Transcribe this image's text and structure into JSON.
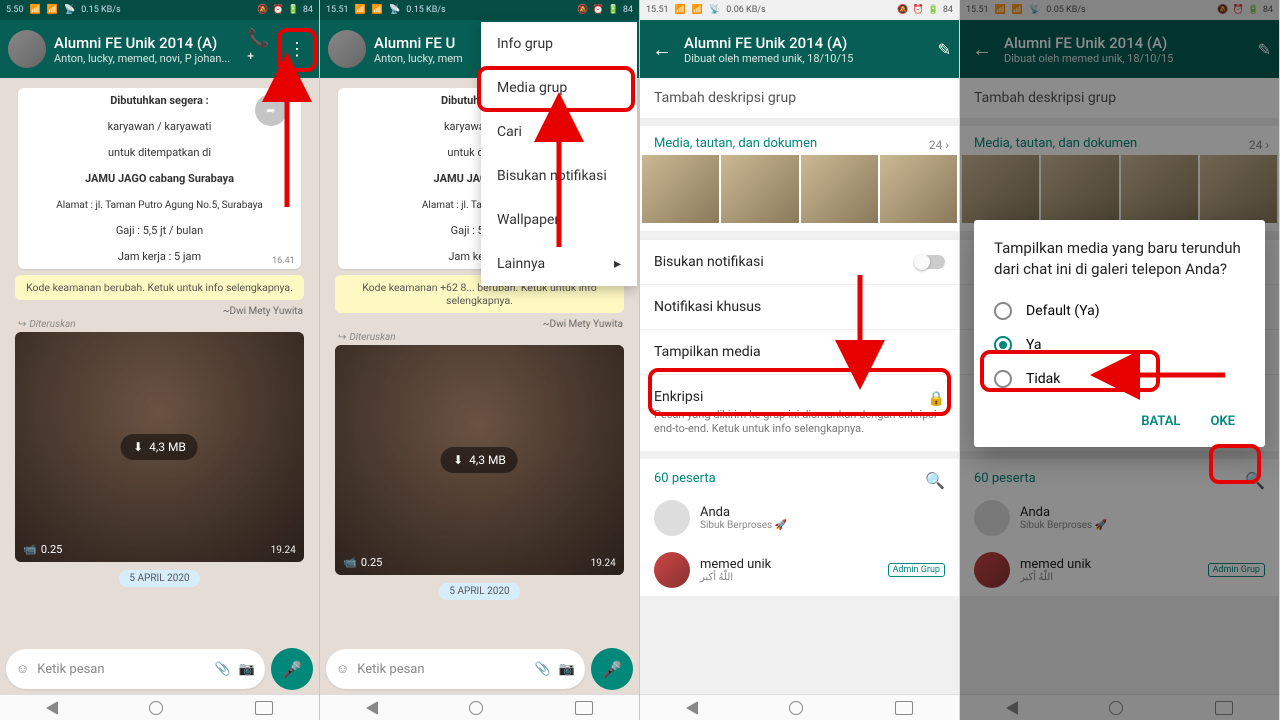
{
  "status1": {
    "time": "5.50",
    "net": "0.15 KB/s",
    "battery": "84"
  },
  "status2": {
    "time": "15.51",
    "net": "0.15 KB/s",
    "battery": "84"
  },
  "status3": {
    "time": "15.51",
    "net": "0.06 KB/s",
    "battery": "84"
  },
  "status4": {
    "time": "15.51",
    "net": "0.05 KB/s",
    "battery": "84"
  },
  "chat": {
    "title": "Alumni FE Unik 2014 (A)",
    "members": "Anton, lucky, memed, novi, P johan...",
    "created": "Dibuat oleh memed unik, 18/10/15",
    "msg_lines": [
      "Dibutuhkan segera :",
      "karyawan / karyawati",
      "untuk ditempatkan di",
      "JAMU JAGO cabang Surabaya",
      "Alamat : jl. Taman Putro Agung No.5, Surabaya",
      "Gaji : 5,5 jt / bulan",
      "Jam kerja : 5 jam"
    ],
    "msg_time": "16.41",
    "sec_notice": "Kode keamanan                        berubah. Ketuk untuk info selengkapnya.",
    "sec_notice2": "Kode keamanan +62 8... berubah. Ketuk untuk info selengkapnya.",
    "sender": "~Dwi Mety Yuwita",
    "forward": "Diteruskan",
    "dl_size": "4,3 MB",
    "vid_len": "0.25",
    "vid_time": "19.24",
    "date": "5 APRIL 2020",
    "compose": "Ketik pesan"
  },
  "menu": {
    "items": [
      "Info grup",
      "Media grup",
      "Cari",
      "Bisukan notifikasi",
      "Wallpaper",
      "Lainnya"
    ]
  },
  "info": {
    "desc": "Tambah deskripsi grup",
    "media_h": "Media, tautan, dan dokumen",
    "media_count": "24",
    "mute": "Bisukan notifikasi",
    "custom": "Notifikasi khusus",
    "show_media": "Tampilkan media",
    "encrypt": "Enkripsi",
    "encrypt_sub": "Pesan yang dikirim ke grup ini diamankan dengan enkripsi end-to-end. Ketuk untuk info selengkapnya.",
    "participants": "60 peserta",
    "p1_name": "Anda",
    "p1_status": "Sibuk Berproses 🚀",
    "p2_name": "memed unik",
    "p2_status": "اللّهُ أكبر",
    "admin": "Admin Grup"
  },
  "dialog": {
    "title": "Tampilkan media yang baru terunduh dari chat ini di galeri telepon Anda?",
    "opt1": "Default (Ya)",
    "opt2": "Ya",
    "opt3": "Tidak",
    "cancel": "BATAL",
    "ok": "OKE"
  }
}
